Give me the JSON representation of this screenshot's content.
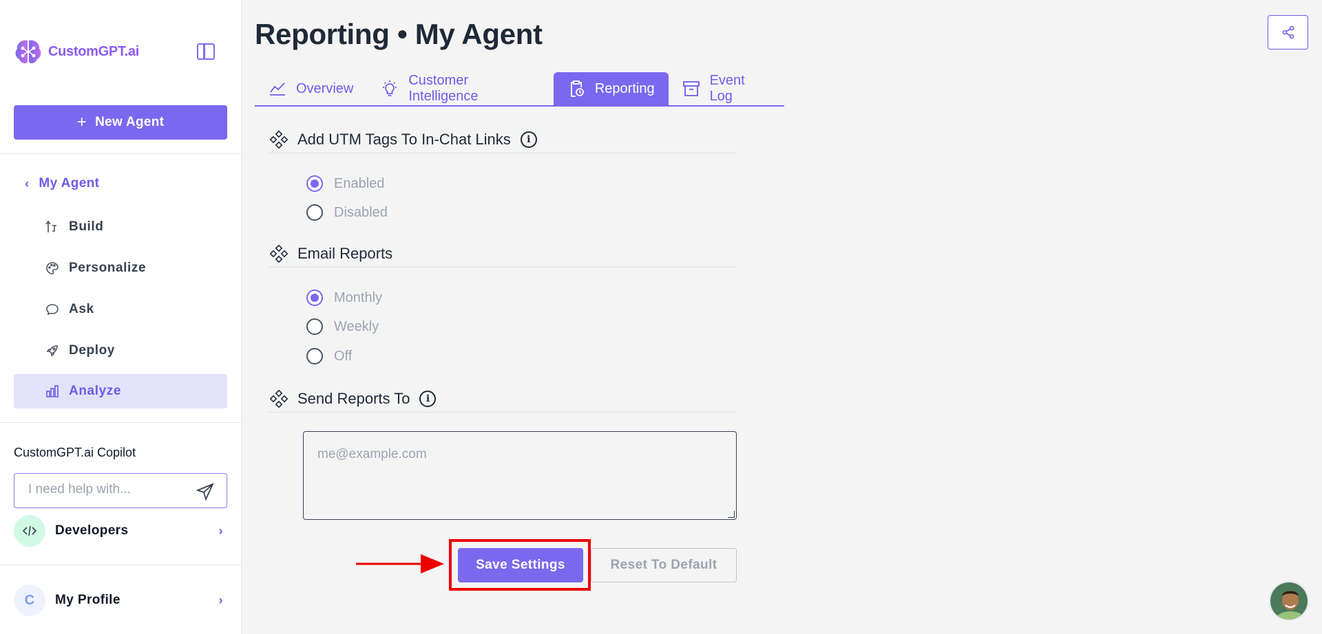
{
  "brand": {
    "name": "CustomGPT.ai"
  },
  "sidebar": {
    "new_agent_label": "New Agent",
    "back_label": "My Agent",
    "items": [
      {
        "label": "Build",
        "icon": "build-icon"
      },
      {
        "label": "Personalize",
        "icon": "palette-icon"
      },
      {
        "label": "Ask",
        "icon": "chat-icon"
      },
      {
        "label": "Deploy",
        "icon": "rocket-icon"
      },
      {
        "label": "Analyze",
        "icon": "bar-chart-icon",
        "active": true
      }
    ],
    "copilot": {
      "title": "CustomGPT.ai Copilot",
      "placeholder": "I need help with..."
    },
    "developers_label": "Developers",
    "profile": {
      "initial": "C",
      "label": "My Profile"
    }
  },
  "header": {
    "title": "Reporting • My Agent"
  },
  "tabs": [
    {
      "label": "Overview",
      "icon": "trend-line-icon"
    },
    {
      "label": "Customer Intelligence",
      "icon": "lightbulb-icon"
    },
    {
      "label": "Reporting",
      "icon": "clipboard-clock-icon",
      "active": true
    },
    {
      "label": "Event Log",
      "icon": "archive-icon"
    }
  ],
  "sections": {
    "utm": {
      "title": "Add UTM Tags To In-Chat Links",
      "options": [
        {
          "label": "Enabled",
          "selected": true
        },
        {
          "label": "Disabled",
          "selected": false
        }
      ]
    },
    "email_reports": {
      "title": "Email Reports",
      "options": [
        {
          "label": "Monthly",
          "selected": true
        },
        {
          "label": "Weekly",
          "selected": false
        },
        {
          "label": "Off",
          "selected": false
        }
      ]
    },
    "send_to": {
      "title": "Send Reports To",
      "placeholder": "me@example.com",
      "value": ""
    }
  },
  "actions": {
    "save_label": "Save Settings",
    "reset_label": "Reset To Default"
  },
  "colors": {
    "accent": "#7b68ee",
    "highlight": "#ee0000",
    "active_bg": "#e4e1fb"
  }
}
